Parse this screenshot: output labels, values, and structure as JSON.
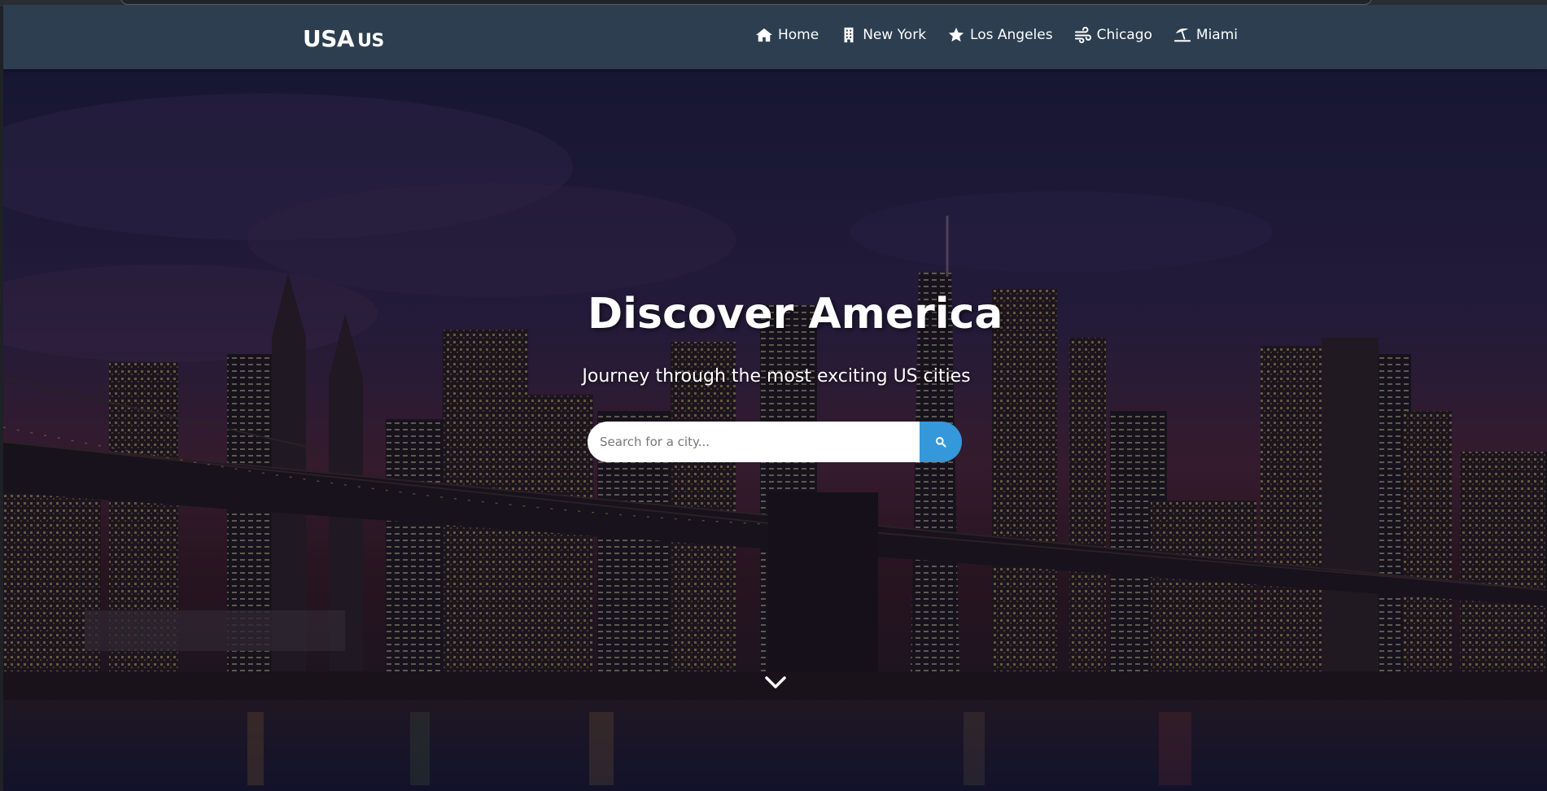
{
  "navbar": {
    "logo_main": "USA",
    "logo_suffix": "US",
    "background": "#2c3e50",
    "items": [
      {
        "label": "Home",
        "icon": "home-icon"
      },
      {
        "label": "New York",
        "icon": "building-icon"
      },
      {
        "label": "Los Angeles",
        "icon": "star-icon"
      },
      {
        "label": "Chicago",
        "icon": "wind-icon"
      },
      {
        "label": "Miami",
        "icon": "umbrella-beach-icon"
      }
    ]
  },
  "hero": {
    "title": "Discover America",
    "subtitle": "Journey through the most exciting US cities",
    "background_image": "city-skyline-night",
    "search": {
      "placeholder": "Search for a city...",
      "value": "",
      "button_icon": "search-icon",
      "button_color": "#3498db"
    },
    "scroll_icon": "chevron-down-icon"
  }
}
